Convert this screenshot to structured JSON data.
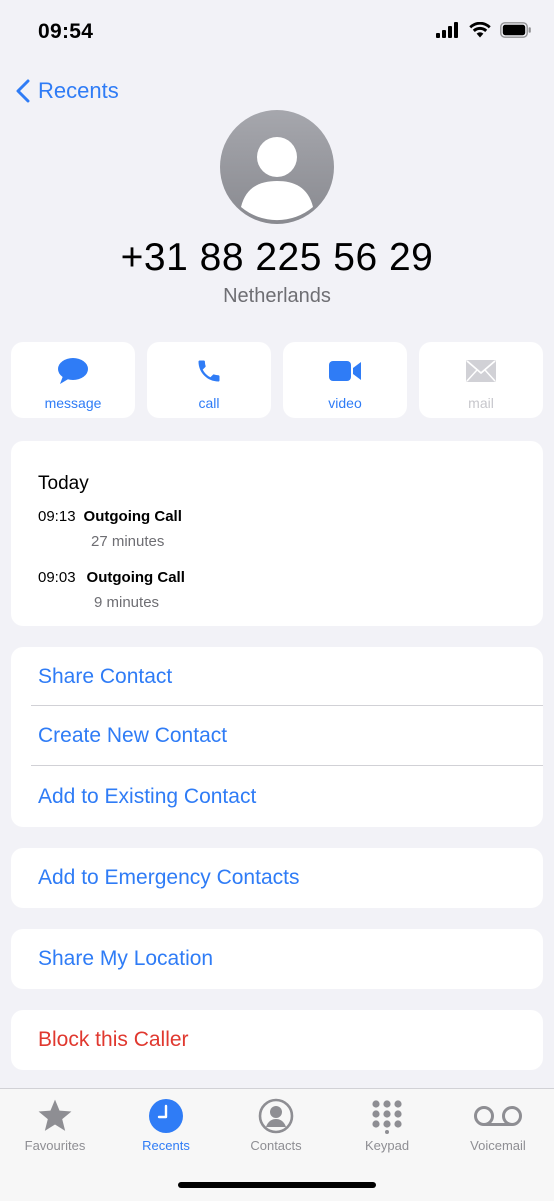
{
  "status_bar": {
    "time": "09:54"
  },
  "nav": {
    "back_label": "Recents"
  },
  "contact": {
    "number": "+31 88 225 56 29",
    "country": "Netherlands"
  },
  "actions": [
    {
      "label": "message",
      "icon": "message-icon",
      "enabled": true
    },
    {
      "label": "call",
      "icon": "phone-icon",
      "enabled": true
    },
    {
      "label": "video",
      "icon": "video-icon",
      "enabled": true
    },
    {
      "label": "mail",
      "icon": "mail-icon",
      "enabled": false
    }
  ],
  "history": {
    "day": "Today",
    "calls": [
      {
        "time": "09:13",
        "type": "Outgoing Call",
        "duration": "27 minutes"
      },
      {
        "time": "09:03",
        "type": "Outgoing Call",
        "duration": "9 minutes"
      }
    ]
  },
  "menu": {
    "share_contact": "Share Contact",
    "create_new_contact": "Create New Contact",
    "add_to_existing": "Add to Existing Contact",
    "add_emergency": "Add to Emergency Contacts",
    "share_location": "Share My Location",
    "block_caller": "Block this Caller"
  },
  "tabs": [
    {
      "label": "Favourites",
      "icon": "star-icon",
      "active": false
    },
    {
      "label": "Recents",
      "icon": "clock-icon",
      "active": true
    },
    {
      "label": "Contacts",
      "icon": "person-circle-icon",
      "active": false
    },
    {
      "label": "Keypad",
      "icon": "keypad-icon",
      "active": false
    },
    {
      "label": "Voicemail",
      "icon": "voicemail-icon",
      "active": false
    }
  ],
  "colors": {
    "accent": "#2f7cf6",
    "destructive": "#e0382f",
    "background": "#f2f2f7",
    "inactive": "#8e8e93"
  }
}
